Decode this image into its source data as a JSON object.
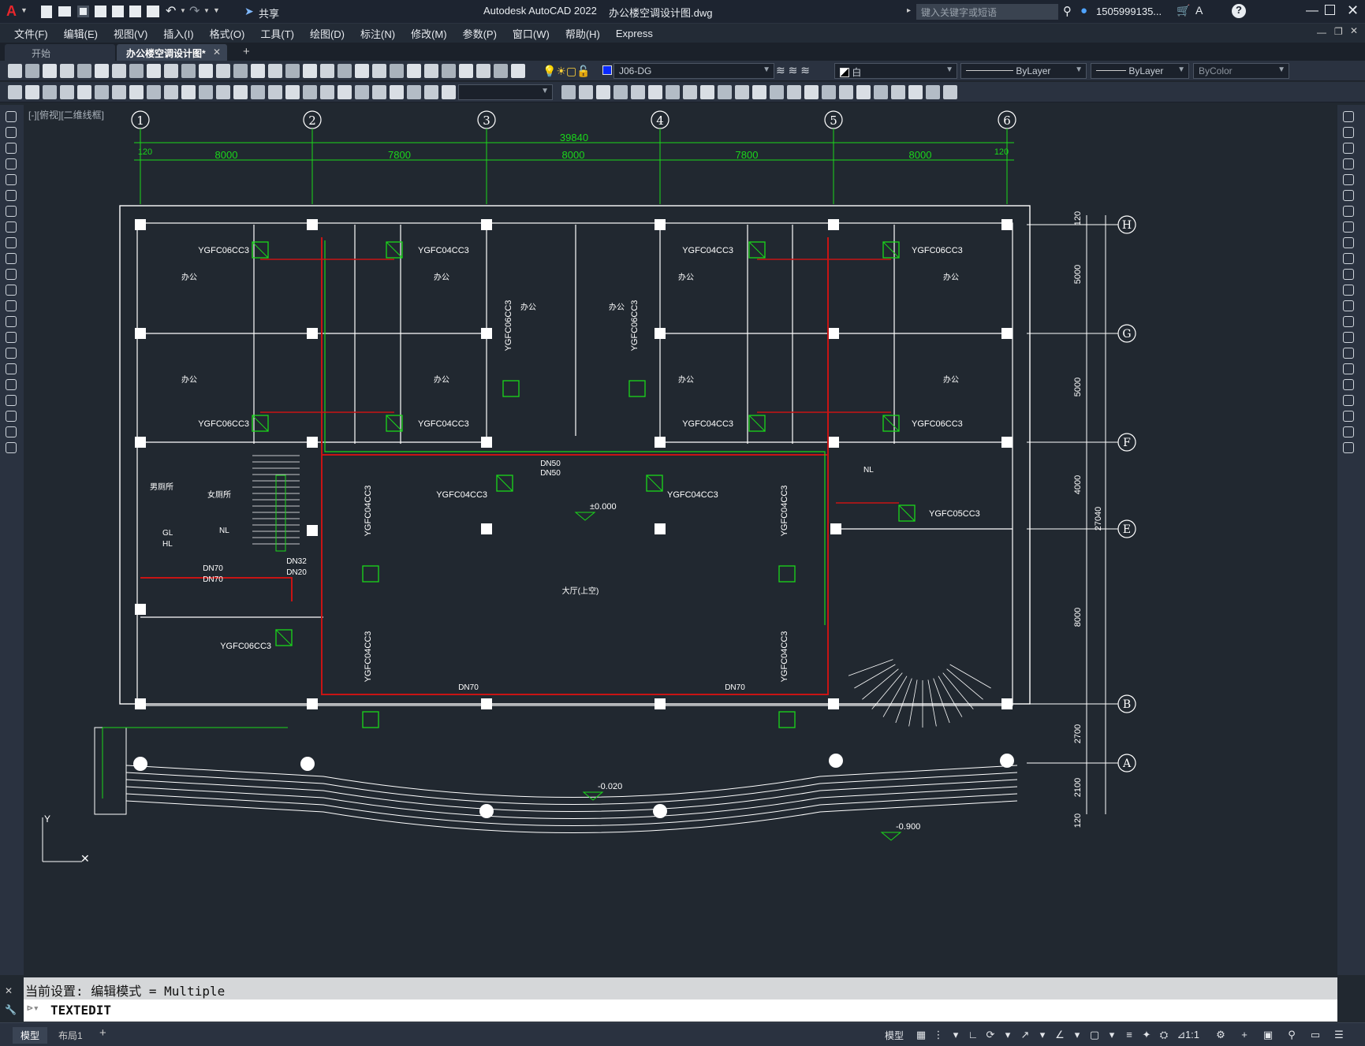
{
  "titlebar": {
    "app_title": "Autodesk AutoCAD 2022",
    "file_name": "办公楼空调设计图.dwg",
    "share_label": "共享",
    "search_placeholder": "键入关键字或短语",
    "user": "1505999135...",
    "help": "?"
  },
  "menu": [
    "文件(F)",
    "编辑(E)",
    "视图(V)",
    "插入(I)",
    "格式(O)",
    "工具(T)",
    "绘图(D)",
    "标注(N)",
    "修改(M)",
    "参数(P)",
    "窗口(W)",
    "帮助(H)",
    "Express"
  ],
  "tabs": {
    "start": "开始",
    "active": "办公楼空调设计图*",
    "add": "+"
  },
  "properties": {
    "layer": "J06-DG",
    "color": "白",
    "linetype": "ByLayer",
    "lineweight": "ByLayer",
    "plotstyle": "ByColor"
  },
  "viewport_label": "[-][俯视][二维线框]",
  "drawing": {
    "grid_numbers": [
      "1",
      "2",
      "3",
      "4",
      "5",
      "6"
    ],
    "grid_letters": [
      "H",
      "G",
      "F",
      "E",
      "B",
      "A"
    ],
    "overall_dim": "39840",
    "spans": [
      "8000",
      "7800",
      "8000",
      "7800",
      "8000"
    ],
    "edge_dims": [
      "120",
      "120"
    ],
    "vertical_dims": [
      "120",
      "5000",
      "5000",
      "4000",
      "8000",
      "2700",
      "2100",
      "120"
    ],
    "total_vertical": "27040",
    "units": [
      {
        "label": "YGFC06CC3"
      },
      {
        "label": "YGFC04CC3"
      },
      {
        "label": "YGFC04CC3"
      },
      {
        "label": "YGFC06CC3"
      },
      {
        "label": "YGFC06CC3"
      },
      {
        "label": "YGFC04CC3"
      },
      {
        "label": "YGFC04CC3"
      },
      {
        "label": "YGFC06CC3"
      },
      {
        "label": "YGFC04CC3"
      },
      {
        "label": "YGFC04CC3"
      },
      {
        "label": "YGFC05CC3"
      },
      {
        "label": "YGFC06CC3"
      },
      {
        "label": "YGFC06CC3"
      },
      {
        "label": "YGFC06CC3"
      },
      {
        "label": "YGFC04CC3"
      },
      {
        "label": "YGFC04CC3"
      },
      {
        "label": "YGFC04CC3"
      },
      {
        "label": "YGFC04CC3"
      }
    ],
    "rooms": [
      "办公",
      "办公",
      "办公",
      "办公",
      "办公",
      "办公",
      "办公",
      "办公",
      "办公",
      "办公",
      "男厕所",
      "女厕所",
      "大厅(上空)"
    ],
    "pipes": [
      "DN70",
      "DN70",
      "DN70",
      "DN70",
      "DN50",
      "DN50",
      "DN32",
      "DN20"
    ],
    "elevations": [
      "±0.000",
      "-0.020",
      "-0.900"
    ],
    "misc": [
      "GL",
      "HL",
      "NL",
      "NL"
    ]
  },
  "command": {
    "history": "当前设置: 编辑模式 = Multiple",
    "input": "TEXTEDIT"
  },
  "status": {
    "model_tab": "模型",
    "layout_tab": "布局1",
    "add_tab": "+",
    "model_btn": "模型",
    "scale": "1:1"
  }
}
